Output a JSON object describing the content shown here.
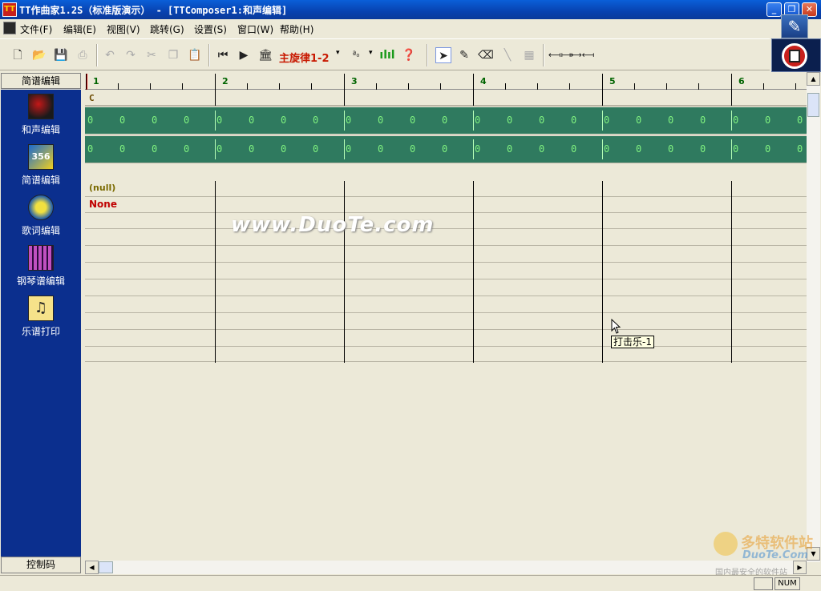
{
  "window": {
    "title": "TT作曲家1.2S（标准版演示） - [TTComposer1:和声编辑]",
    "app_icon_text": "TT",
    "buttons": {
      "minimize": "_",
      "maximize": "❐",
      "close": "✕"
    }
  },
  "menu": [
    {
      "label": "文件(F)"
    },
    {
      "label": "编辑(E)"
    },
    {
      "label": "视图(V)"
    },
    {
      "label": "跳转(G)"
    },
    {
      "label": "设置(S)"
    },
    {
      "label": "窗口(W)"
    },
    {
      "label": "帮助(H)"
    }
  ],
  "toolbar": {
    "melody_label": "主旋律1-2",
    "dropdown_glyph": "▾"
  },
  "sidebar": {
    "header": "简谱编辑",
    "items": [
      {
        "label": "和声编辑",
        "icon": "harmony-edit-icon"
      },
      {
        "label": "简谱编辑",
        "icon": "numbered-notation-icon"
      },
      {
        "label": "歌词编辑",
        "icon": "lyrics-edit-icon"
      },
      {
        "label": "钢琴谱编辑",
        "icon": "piano-score-icon"
      },
      {
        "label": "乐谱打印",
        "icon": "score-print-icon"
      }
    ],
    "footer": "控制码"
  },
  "grid": {
    "measures": [
      "1",
      "2",
      "3",
      "4",
      "5",
      "6"
    ],
    "chord": "C",
    "band_value": "0",
    "null_text": "(null)",
    "none_text": "None"
  },
  "watermark": "www.DuoTe.com",
  "tooltip": "打击乐-1",
  "brand_watermark": {
    "name": "多特软件站",
    "url": "DuoTe.Com",
    "slogan": "国内最安全的软件站"
  },
  "status": {
    "num": "NUM"
  },
  "colors": {
    "title_bar": "#0842b0",
    "sidebar_bg": "#0b2f8e",
    "band_green": "#2f7a5f",
    "band_text": "#7ff07f",
    "melody_red": "#c81800",
    "none_red": "#c00000",
    "measure_number": "#006400"
  }
}
